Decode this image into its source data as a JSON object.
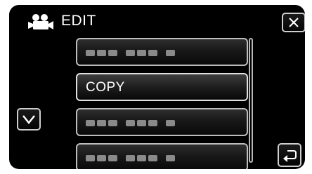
{
  "header": {
    "title": "EDIT",
    "mode_icon": "movie-camera-icon"
  },
  "buttons": {
    "close_icon": "close-icon",
    "scroll_down_icon": "chevron-down-icon",
    "back_icon": "return-arrow-icon"
  },
  "menu": {
    "items": [
      {
        "label": "",
        "placeholder": true
      },
      {
        "label": "COPY",
        "placeholder": false,
        "selected": true
      },
      {
        "label": "",
        "placeholder": true
      },
      {
        "label": "",
        "placeholder": true
      }
    ]
  }
}
